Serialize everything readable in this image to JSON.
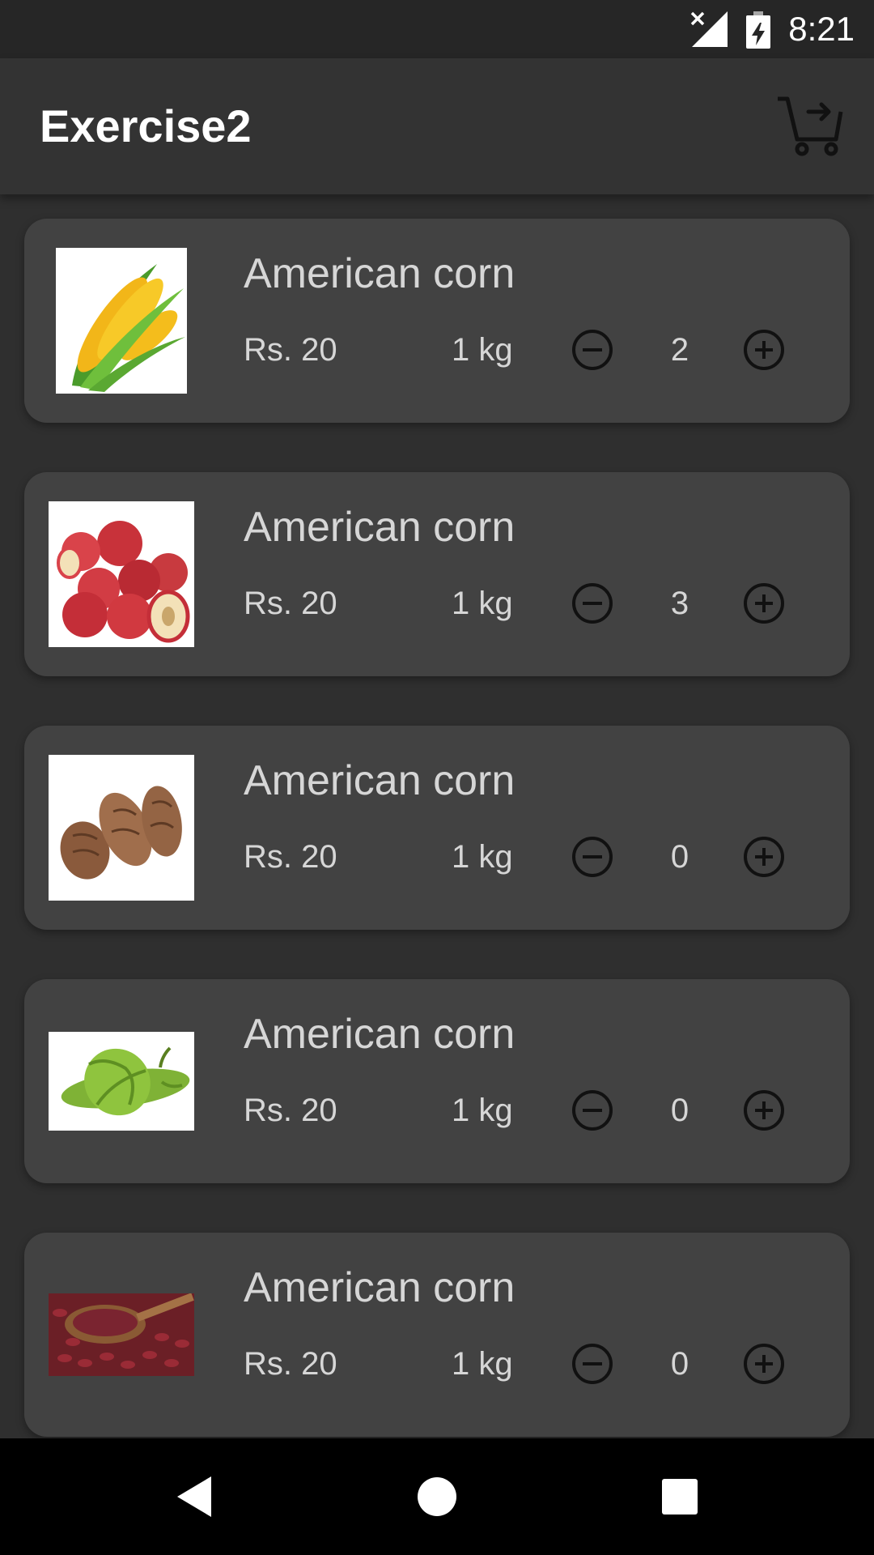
{
  "status_bar": {
    "time": "8:21",
    "signal_icon": "signal-no-service-icon",
    "battery_icon": "battery-charging-icon"
  },
  "app_bar": {
    "title": "Exercise2",
    "cart_icon": "cart-arrow-icon"
  },
  "products": [
    {
      "name": "American corn",
      "price": "Rs. 20",
      "weight": "1 kg",
      "quantity": "2",
      "image": "corn-image"
    },
    {
      "name": "American corn",
      "price": "Rs. 20",
      "weight": "1 kg",
      "quantity": "3",
      "image": "apple-image"
    },
    {
      "name": "American corn",
      "price": "Rs. 20",
      "weight": "1 kg",
      "quantity": "0",
      "image": "taro-image"
    },
    {
      "name": "American corn",
      "price": "Rs. 20",
      "weight": "1 kg",
      "quantity": "0",
      "image": "bitter-gourd-image"
    },
    {
      "name": "American corn",
      "price": "Rs. 20",
      "weight": "1 kg",
      "quantity": "0",
      "image": "kidney-beans-image"
    }
  ],
  "nav_bar": {
    "back_icon": "back-triangle-icon",
    "home_icon": "home-circle-icon",
    "recents_icon": "recents-square-icon"
  },
  "colors": {
    "background": "#2f2f2f",
    "app_bar": "#333333",
    "card": "#424242",
    "text": "#d6d6d6"
  }
}
